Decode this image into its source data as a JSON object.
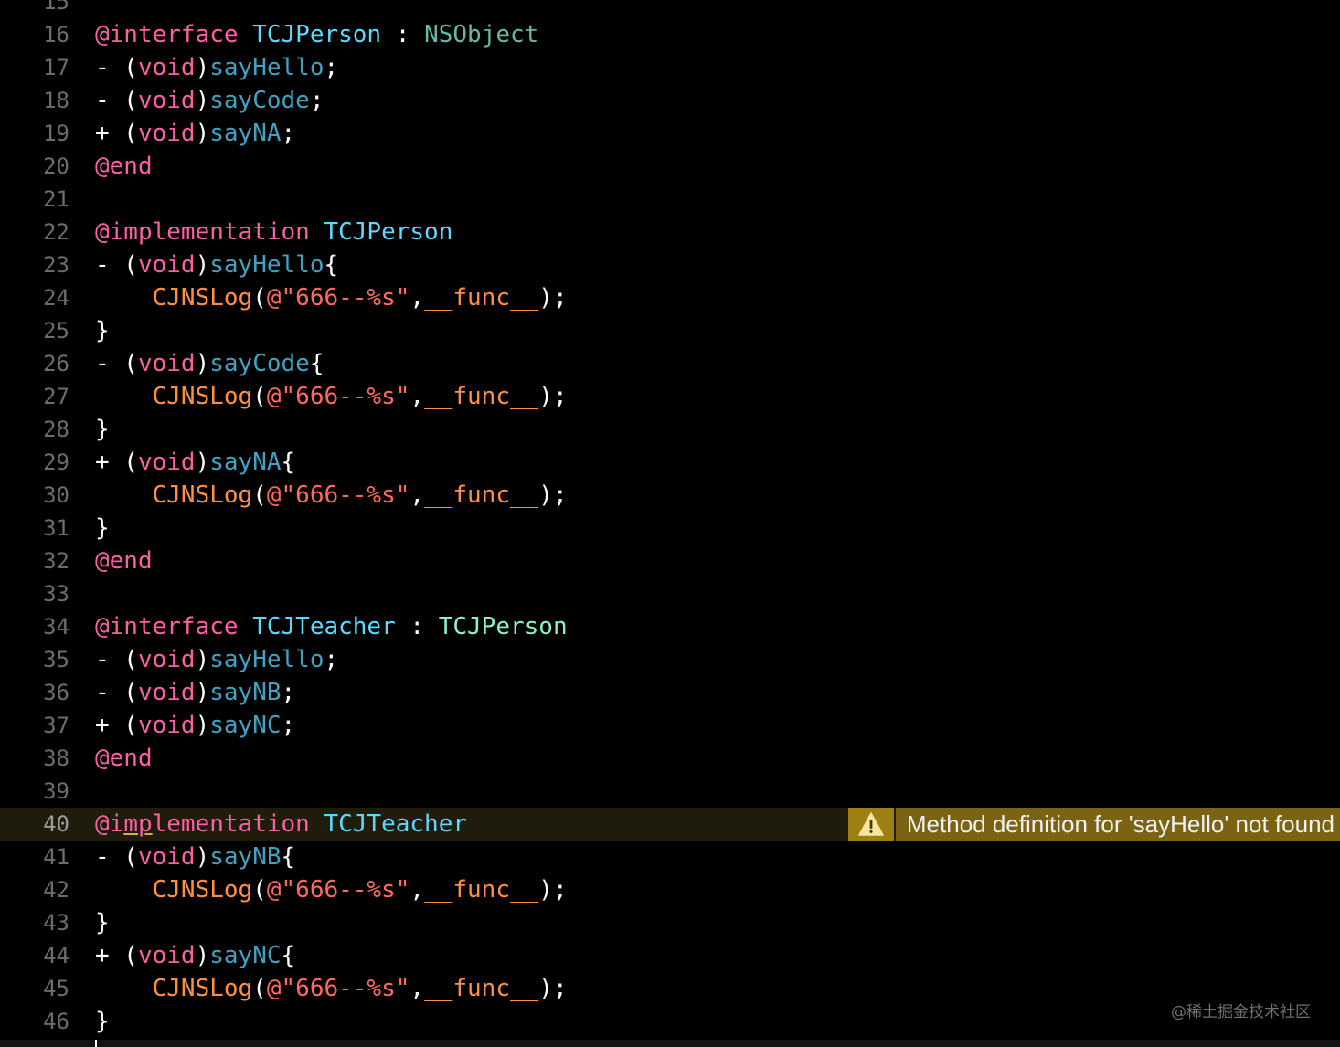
{
  "lines": [
    {
      "n": "15",
      "tokens": []
    },
    {
      "n": "16",
      "tokens": [
        [
          "kw",
          "@interface"
        ],
        [
          "pl",
          " "
        ],
        [
          "decl",
          "TCJPerson"
        ],
        [
          "pl",
          " : "
        ],
        [
          "sys",
          "NSObject"
        ]
      ]
    },
    {
      "n": "17",
      "tokens": [
        [
          "pl",
          "- ("
        ],
        [
          "kw",
          "void"
        ],
        [
          "pl",
          ")"
        ],
        [
          "usr",
          "sayHello"
        ],
        [
          "pl",
          ";"
        ]
      ]
    },
    {
      "n": "18",
      "tokens": [
        [
          "pl",
          "- ("
        ],
        [
          "kw",
          "void"
        ],
        [
          "pl",
          ")"
        ],
        [
          "usr",
          "sayCode"
        ],
        [
          "pl",
          ";"
        ]
      ]
    },
    {
      "n": "19",
      "tokens": [
        [
          "pl",
          "+ ("
        ],
        [
          "kw",
          "void"
        ],
        [
          "pl",
          ")"
        ],
        [
          "usr",
          "sayNA"
        ],
        [
          "pl",
          ";"
        ]
      ]
    },
    {
      "n": "20",
      "tokens": [
        [
          "kw",
          "@end"
        ]
      ]
    },
    {
      "n": "21",
      "tokens": []
    },
    {
      "n": "22",
      "tokens": [
        [
          "kw",
          "@implementation"
        ],
        [
          "pl",
          " "
        ],
        [
          "decl",
          "TCJPerson"
        ]
      ]
    },
    {
      "n": "23",
      "tokens": [
        [
          "pl",
          "- ("
        ],
        [
          "kw",
          "void"
        ],
        [
          "pl",
          ")"
        ],
        [
          "usr",
          "sayHello"
        ],
        [
          "pl",
          "{"
        ]
      ]
    },
    {
      "n": "24",
      "tokens": [
        [
          "pl",
          "    "
        ],
        [
          "mac",
          "CJNSLog"
        ],
        [
          "pl",
          "("
        ],
        [
          "str",
          "@\"666--%s\""
        ],
        [
          "pl",
          ","
        ],
        [
          "mac",
          "__func__"
        ],
        [
          "pl",
          ");"
        ]
      ]
    },
    {
      "n": "25",
      "tokens": [
        [
          "pl",
          "}"
        ]
      ]
    },
    {
      "n": "26",
      "tokens": [
        [
          "pl",
          "- ("
        ],
        [
          "kw",
          "void"
        ],
        [
          "pl",
          ")"
        ],
        [
          "usr",
          "sayCode"
        ],
        [
          "pl",
          "{"
        ]
      ]
    },
    {
      "n": "27",
      "tokens": [
        [
          "pl",
          "    "
        ],
        [
          "mac",
          "CJNSLog"
        ],
        [
          "pl",
          "("
        ],
        [
          "str",
          "@\"666--%s\""
        ],
        [
          "pl",
          ","
        ],
        [
          "mac",
          "__func__"
        ],
        [
          "pl",
          ");"
        ]
      ]
    },
    {
      "n": "28",
      "tokens": [
        [
          "pl",
          "}"
        ]
      ]
    },
    {
      "n": "29",
      "tokens": [
        [
          "pl",
          "+ ("
        ],
        [
          "kw",
          "void"
        ],
        [
          "pl",
          ")"
        ],
        [
          "usr",
          "sayNA"
        ],
        [
          "pl",
          "{"
        ]
      ]
    },
    {
      "n": "30",
      "tokens": [
        [
          "pl",
          "    "
        ],
        [
          "mac",
          "CJNSLog"
        ],
        [
          "pl",
          "("
        ],
        [
          "str",
          "@\"666--%s\""
        ],
        [
          "pl",
          ","
        ],
        [
          "mac",
          "__func__"
        ],
        [
          "pl",
          ");"
        ]
      ]
    },
    {
      "n": "31",
      "tokens": [
        [
          "pl",
          "}"
        ]
      ]
    },
    {
      "n": "32",
      "tokens": [
        [
          "kw",
          "@end"
        ]
      ]
    },
    {
      "n": "33",
      "tokens": []
    },
    {
      "n": "34",
      "tokens": [
        [
          "kw",
          "@interface"
        ],
        [
          "pl",
          " "
        ],
        [
          "decl",
          "TCJTeacher"
        ],
        [
          "pl",
          " : "
        ],
        [
          "cls",
          "TCJPerson"
        ]
      ]
    },
    {
      "n": "35",
      "tokens": [
        [
          "pl",
          "- ("
        ],
        [
          "kw",
          "void"
        ],
        [
          "pl",
          ")"
        ],
        [
          "usr",
          "sayHello"
        ],
        [
          "pl",
          ";"
        ]
      ]
    },
    {
      "n": "36",
      "tokens": [
        [
          "pl",
          "- ("
        ],
        [
          "kw",
          "void"
        ],
        [
          "pl",
          ")"
        ],
        [
          "usr",
          "sayNB"
        ],
        [
          "pl",
          ";"
        ]
      ]
    },
    {
      "n": "37",
      "tokens": [
        [
          "pl",
          "+ ("
        ],
        [
          "kw",
          "void"
        ],
        [
          "pl",
          ")"
        ],
        [
          "usr",
          "sayNC"
        ],
        [
          "pl",
          ";"
        ]
      ]
    },
    {
      "n": "38",
      "tokens": [
        [
          "kw",
          "@end"
        ]
      ]
    },
    {
      "n": "39",
      "tokens": []
    },
    {
      "n": "40",
      "current": true,
      "tokens": [
        [
          "kw",
          "@i"
        ],
        [
          "kwu",
          "mp"
        ],
        [
          "kw",
          "lementation"
        ],
        [
          "pl",
          " "
        ],
        [
          "decl",
          "TCJTeacher"
        ]
      ]
    },
    {
      "n": "41",
      "tokens": [
        [
          "pl",
          "- ("
        ],
        [
          "kw",
          "void"
        ],
        [
          "pl",
          ")"
        ],
        [
          "usr",
          "sayNB"
        ],
        [
          "pl",
          "{"
        ]
      ]
    },
    {
      "n": "42",
      "tokens": [
        [
          "pl",
          "    "
        ],
        [
          "mac",
          "CJNSLog"
        ],
        [
          "pl",
          "("
        ],
        [
          "str",
          "@\"666--%s\""
        ],
        [
          "pl",
          ","
        ],
        [
          "mac",
          "__func__"
        ],
        [
          "pl",
          ");"
        ]
      ]
    },
    {
      "n": "43",
      "tokens": [
        [
          "pl",
          "}"
        ]
      ]
    },
    {
      "n": "44",
      "tokens": [
        [
          "pl",
          "+ ("
        ],
        [
          "kw",
          "void"
        ],
        [
          "pl",
          ")"
        ],
        [
          "usr",
          "sayNC"
        ],
        [
          "pl",
          "{"
        ]
      ]
    },
    {
      "n": "45",
      "tokens": [
        [
          "pl",
          "    "
        ],
        [
          "mac",
          "CJNSLog"
        ],
        [
          "pl",
          "("
        ],
        [
          "str",
          "@\"666--%s\""
        ],
        [
          "pl",
          ","
        ],
        [
          "mac",
          "__func__"
        ],
        [
          "pl",
          ");"
        ]
      ]
    },
    {
      "n": "46",
      "tokens": [
        [
          "pl",
          "}"
        ]
      ]
    }
  ],
  "warning": {
    "line": "40",
    "message": "Method definition for 'sayHello' not found",
    "icon": "warning-triangle-icon"
  },
  "watermark": "@稀土掘金技术社区",
  "colors": {
    "keyword": "#fc5fa3",
    "declaration": "#5dd8ff",
    "method": "#41a1c0",
    "system_type": "#67b7a4",
    "class_ref": "#8cf0c0",
    "macro": "#fd8f3f",
    "string": "#fc6a5d",
    "warning_bg": "#7a6414"
  }
}
